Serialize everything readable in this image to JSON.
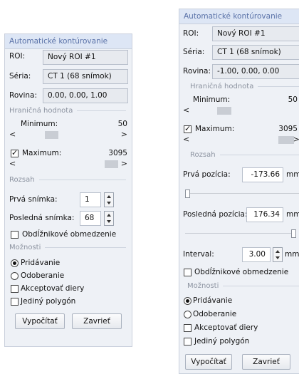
{
  "left": {
    "title": "Automatické kontúrovanie",
    "roi_label": "ROI:",
    "roi_value": "Nový ROI #1",
    "seria_label": "Séria:",
    "seria_value": "CT 1 (68 snímok)",
    "rovina_label": "Rovina:",
    "rovina_value": "0.00, 0.00, 1.00",
    "hranicna": "Hraničná hodnota",
    "minimum_label": "Minimum:",
    "minimum_value": "50",
    "maximum_label": "Maximum:",
    "maximum_value": "3095",
    "maximum_checked": true,
    "rozsah": "Rozsah",
    "prva_label": "Prvá snímka:",
    "prva_value": "1",
    "posledna_label": "Posledná snímka:",
    "posledna_value": "68",
    "obdlz_label": "Obdĺžnikové obmedzenie",
    "moznosti": "Možnosti",
    "pridavanie": "Pridávanie",
    "odoberanie": "Odoberanie",
    "akceptovat": "Akceptovať diery",
    "jediny": "Jediný polygón",
    "vypocitat": "Vypočítať",
    "zaviert": "Zavrieť"
  },
  "right": {
    "title": "Automatické kontúrovanie",
    "roi_label": "ROI:",
    "roi_value": "Nový ROI #1",
    "seria_label": "Séria:",
    "seria_value": "CT 1 (68 snímok)",
    "rovina_label": "Rovina:",
    "rovina_value": "-1.00, 0.00, 0.00",
    "hranicna": "Hraničná hodnota",
    "minimum_label": "Minimum:",
    "minimum_value": "50",
    "maximum_label": "Maximum:",
    "maximum_value": "3095",
    "maximum_checked": true,
    "rozsah": "Rozsah",
    "prva_label": "Prvá pozícia:",
    "prva_value": "-173.66",
    "prva_unit": "mm",
    "posledna_label": "Posledná pozícia:",
    "posledna_value": "176.34",
    "posledna_unit": "mm",
    "interval_label": "Interval:",
    "interval_value": "3.00",
    "interval_unit": "mm",
    "obdlz_label": "Obdĺžnikové obmedzenie",
    "moznosti": "Možnosti",
    "pridavanie": "Pridávanie",
    "odoberanie": "Odoberanie",
    "akceptovat": "Akceptovať diery",
    "jediny": "Jediný polygón",
    "vypocitat": "Vypočítať",
    "zaviert": "Zavrieť"
  },
  "selected_option": "Pridávanie",
  "colors": {
    "title_text": "#5a72a8",
    "title_bg": "#dde6f5",
    "panel_bg": "#eef1f6"
  }
}
